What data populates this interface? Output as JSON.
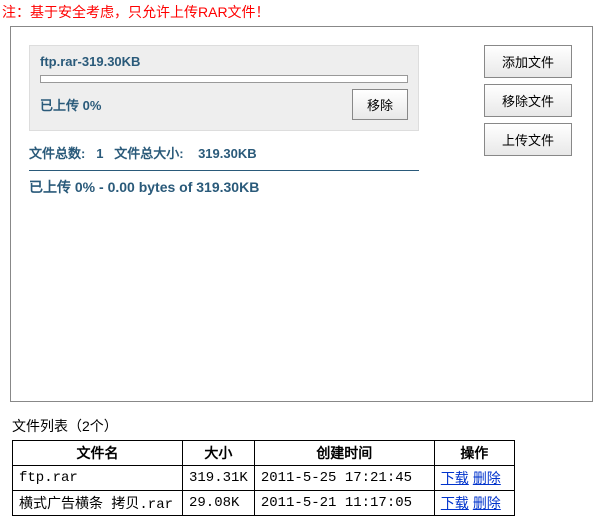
{
  "warning": "注：基于安全考虑，只允许上传RAR文件！",
  "upload": {
    "file_label": "ftp.rar-319.30KB",
    "uploaded_pct": "已上传 0%",
    "remove_btn": "移除",
    "totals_count_label": "文件总数:",
    "totals_count": "1",
    "totals_size_label": "文件总大小:",
    "totals_size": "319.30KB",
    "summary": "已上传 0% - 0.00 bytes of 319.30KB"
  },
  "buttons": {
    "add": "添加文件",
    "remove": "移除文件",
    "upload": "上传文件"
  },
  "list": {
    "title": "文件列表（2个）",
    "headers": {
      "name": "文件名",
      "size": "大小",
      "time": "创建时间",
      "ops": "操作"
    },
    "ops": {
      "download": "下载",
      "delete": "删除"
    },
    "rows": [
      {
        "name": "ftp.rar",
        "size": "319.31K",
        "time": "2011-5-25 17:21:45"
      },
      {
        "name": "横式广告横条 拷贝.rar",
        "size": "29.08K",
        "time": "2011-5-21 11:17:05"
      }
    ]
  }
}
